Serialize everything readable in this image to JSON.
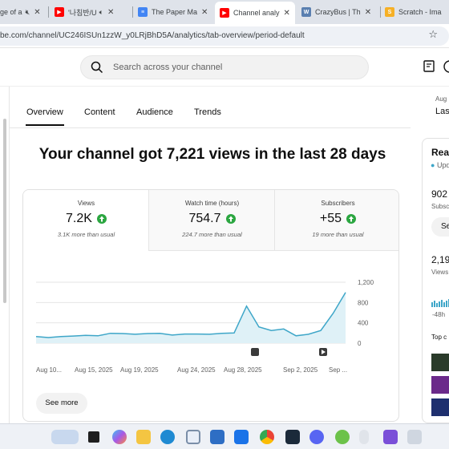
{
  "browser": {
    "tabs": [
      {
        "title": "ge of a",
        "favicon": "generic-icon",
        "muted": false
      },
      {
        "title": "'나침반/U",
        "favicon": "youtube-icon",
        "muted": true
      },
      {
        "title": "The Paper Ma",
        "favicon": "docs-icon",
        "muted": false
      },
      {
        "title": "Channel analy",
        "favicon": "youtube-icon",
        "muted": false,
        "active": true
      },
      {
        "title": "CrazyBus | Th",
        "favicon": "wiki-icon",
        "muted": false
      },
      {
        "title": "Scratch - Ima",
        "favicon": "scratch-icon",
        "muted": false
      }
    ],
    "url": "be.com/channel/UC246ISUn1zzW_y0LRjBhD5A/analytics/tab-overview/period-default"
  },
  "header": {
    "search_placeholder": "Search across your channel"
  },
  "nav_tabs": [
    "Overview",
    "Content",
    "Audience",
    "Trends"
  ],
  "headline": "Your channel got 7,221 views in the last 28 days",
  "metrics": [
    {
      "label": "Views",
      "value": "7.2K",
      "delta": "3.1K more than usual",
      "trend": "up"
    },
    {
      "label": "Watch time (hours)",
      "value": "754.7",
      "delta": "224.7 more than usual",
      "trend": "up"
    },
    {
      "label": "Subscribers",
      "value": "+55",
      "delta": "19 more than usual",
      "trend": "up"
    }
  ],
  "chart_data": {
    "type": "area",
    "x_tick_labels": [
      "Aug 10...",
      "Aug 15, 2025",
      "Aug 19, 2025",
      "Aug 24, 2025",
      "Aug 28, 2025",
      "Sep 2, 2025",
      "Sep ..."
    ],
    "y_tick_labels": [
      "1,200",
      "800",
      "400",
      "0"
    ],
    "ylim": [
      0,
      1200
    ],
    "values": [
      130,
      110,
      130,
      140,
      155,
      145,
      195,
      190,
      175,
      190,
      195,
      160,
      180,
      180,
      175,
      195,
      200,
      730,
      320,
      250,
      280,
      145,
      175,
      250,
      590,
      1000
    ],
    "color": "#3ea6c8",
    "fill": "#dff1f7"
  },
  "see_more_label": "See more",
  "right_panel": {
    "date_small": "Aug",
    "date_large": "Las",
    "title": "Rea",
    "update": "Upd",
    "subs_value": "902",
    "subs_label": "Subsc",
    "see_button": "Se",
    "views_value": "2,19",
    "views_label": "Views",
    "hours_label": "-48h",
    "top_content": "Top c"
  },
  "colors": {
    "accent": "#065fd4",
    "up_green": "#2ba640",
    "youtube_red": "#ff0000"
  }
}
